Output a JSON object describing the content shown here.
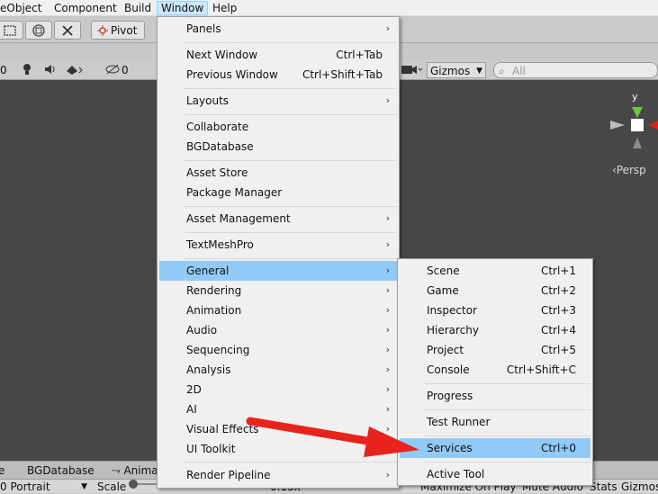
{
  "menubar": {
    "items": [
      "eObject",
      "Component",
      "Build",
      "Window",
      "Help"
    ]
  },
  "toolbar": {
    "pivot_label": "Pivot"
  },
  "scene_toolbar": {
    "left_zero": "0",
    "hidden_count": "0",
    "gizmos_label": "Gizmos",
    "search_placeholder": "All"
  },
  "scene": {
    "gizmo_axis_label": "y",
    "persp_label": "‹Persp"
  },
  "window_menu": {
    "items": [
      {
        "label": "Panels",
        "shortcut": "",
        "submenu": true
      },
      {
        "label": "Next Window",
        "shortcut": "Ctrl+Tab",
        "submenu": false
      },
      {
        "label": "Previous Window",
        "shortcut": "Ctrl+Shift+Tab",
        "submenu": false
      },
      {
        "label": "Layouts",
        "shortcut": "",
        "submenu": true
      },
      {
        "label": "Collaborate",
        "shortcut": "",
        "submenu": false
      },
      {
        "label": "BGDatabase",
        "shortcut": "",
        "submenu": false
      },
      {
        "label": "Asset Store",
        "shortcut": "",
        "submenu": false
      },
      {
        "label": "Package Manager",
        "shortcut": "",
        "submenu": false
      },
      {
        "label": "Asset Management",
        "shortcut": "",
        "submenu": true
      },
      {
        "label": "TextMeshPro",
        "shortcut": "",
        "submenu": true
      },
      {
        "label": "General",
        "shortcut": "",
        "submenu": true
      },
      {
        "label": "Rendering",
        "shortcut": "",
        "submenu": true
      },
      {
        "label": "Animation",
        "shortcut": "",
        "submenu": true
      },
      {
        "label": "Audio",
        "shortcut": "",
        "submenu": true
      },
      {
        "label": "Sequencing",
        "shortcut": "",
        "submenu": true
      },
      {
        "label": "Analysis",
        "shortcut": "",
        "submenu": true
      },
      {
        "label": "2D",
        "shortcut": "",
        "submenu": true
      },
      {
        "label": "AI",
        "shortcut": "",
        "submenu": true
      },
      {
        "label": "Visual Effects",
        "shortcut": "",
        "submenu": true
      },
      {
        "label": "UI Toolkit",
        "shortcut": "",
        "submenu": true
      },
      {
        "label": "Render Pipeline",
        "shortcut": "",
        "submenu": true
      }
    ]
  },
  "general_submenu": {
    "items": [
      {
        "label": "Scene",
        "shortcut": "Ctrl+1"
      },
      {
        "label": "Game",
        "shortcut": "Ctrl+2"
      },
      {
        "label": "Inspector",
        "shortcut": "Ctrl+3"
      },
      {
        "label": "Hierarchy",
        "shortcut": "Ctrl+4"
      },
      {
        "label": "Project",
        "shortcut": "Ctrl+5"
      },
      {
        "label": "Console",
        "shortcut": "Ctrl+Shift+C"
      },
      {
        "label": "Progress",
        "shortcut": ""
      },
      {
        "label": "Test Runner",
        "shortcut": ""
      },
      {
        "label": "Services",
        "shortcut": "Ctrl+0"
      },
      {
        "label": "Active Tool",
        "shortcut": ""
      }
    ]
  },
  "bottom_tabs": {
    "items": [
      "e",
      "BGDatabase",
      "Anima"
    ]
  },
  "game_bar": {
    "resolution": "0 Portrait",
    "scale_label": "Scale",
    "scale_value": "0.15x",
    "maximize": "Maximize On Play",
    "mute": "Mute Audio",
    "stats": "Stats",
    "gizmos": "Gizmos"
  },
  "colors": {
    "highlight": "#91c9f7",
    "arrow": "#e8231c",
    "scene_bg": "#474747"
  }
}
